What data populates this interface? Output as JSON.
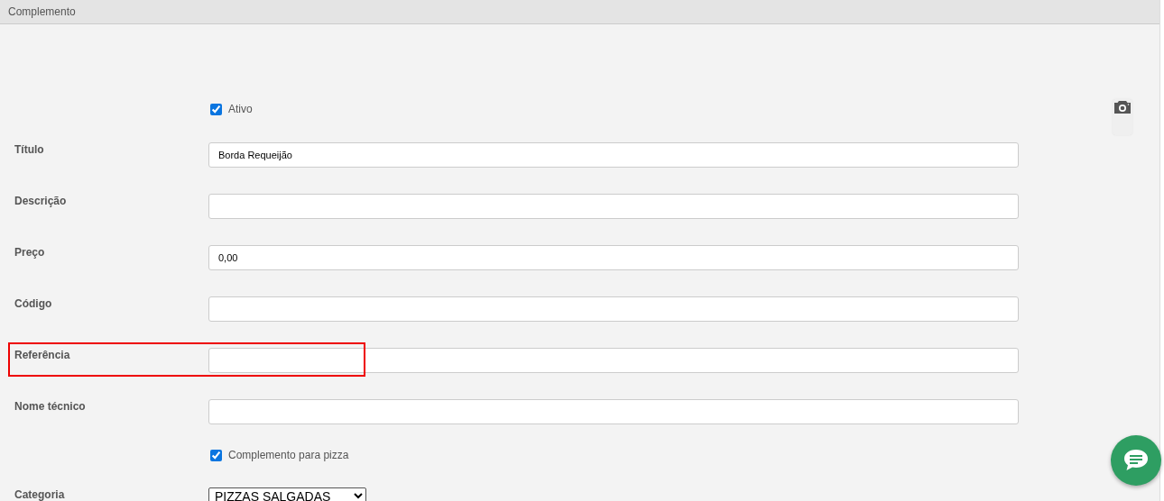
{
  "panel": {
    "title": "Complemento"
  },
  "rows": [
    {
      "kind": "checkbox",
      "label": "Ativo",
      "checked": true
    },
    {
      "kind": "text",
      "label": "Título",
      "value": "Borda Requeijão",
      "highlighted": false
    },
    {
      "kind": "text",
      "label": "Descrição",
      "value": "",
      "highlighted": false
    },
    {
      "kind": "text",
      "label": "Preço",
      "value": "0,00",
      "highlighted": false
    },
    {
      "kind": "text",
      "label": "Código",
      "value": "",
      "highlighted": false
    },
    {
      "kind": "text",
      "label": "Referência",
      "value": "",
      "highlighted": true
    },
    {
      "kind": "text",
      "label": "Nome técnico",
      "value": "",
      "highlighted": false
    },
    {
      "kind": "checkbox",
      "label": "Complemento para pizza",
      "checked": true
    },
    {
      "kind": "select",
      "label": "Categoria",
      "value": "PIZZAS SALGADAS"
    }
  ]
}
